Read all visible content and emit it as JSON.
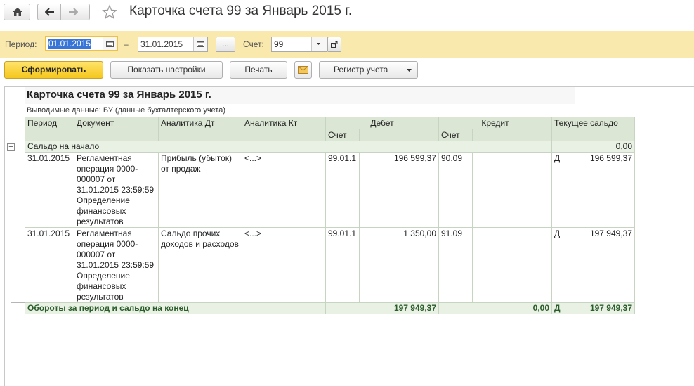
{
  "window": {
    "title": "Карточка счета 99 за Январь 2015 г."
  },
  "params": {
    "period_label": "Период:",
    "date_from": "01.01.2015",
    "dash": "–",
    "date_to": "31.01.2015",
    "more_label": "...",
    "account_label": "Счет:",
    "account_value": "99"
  },
  "toolbar": {
    "generate_label": "Сформировать",
    "settings_label": "Показать настройки",
    "print_label": "Печать",
    "register_label": "Регистр учета"
  },
  "report": {
    "title": "Карточка счета 99 за Январь 2015 г.",
    "meta": "Выводимые данные:  БУ (данные бухгалтерского учета)",
    "headers": {
      "period": "Период",
      "document": "Документ",
      "analytics_dt": "Аналитика Дт",
      "analytics_kt": "Аналитика Кт",
      "debit": "Дебет",
      "credit": "Кредит",
      "balance": "Текущее сальдо",
      "debit_account": "Счет",
      "credit_account": "Счет"
    },
    "opening": {
      "label": "Сальдо на начало",
      "value": "0,00"
    },
    "rows": [
      {
        "period": "31.01.2015",
        "document": "Регламентная операция 0000-000007 от 31.01.2015 23:59:59 Определение финансовых результатов",
        "analytics_dt": "Прибыль (убыток) от продаж",
        "analytics_kt": "<...>",
        "debit_account": "99.01.1",
        "debit_amount": "196 599,37",
        "credit_account": "90.09",
        "credit_amount": "",
        "balance_sign": "Д",
        "balance_amount": "196 599,37"
      },
      {
        "period": "31.01.2015",
        "document": "Регламентная операция 0000-000007 от 31.01.2015 23:59:59 Определение финансовых результатов",
        "analytics_dt": "Сальдо прочих доходов и расходов",
        "analytics_kt": "<...>",
        "debit_account": "99.01.1",
        "debit_amount": "1 350,00",
        "credit_account": "91.09",
        "credit_amount": "",
        "balance_sign": "Д",
        "balance_amount": "197 949,37"
      }
    ],
    "totals": {
      "label": "Обороты за период и сальдо на конец",
      "debit": "197 949,37",
      "credit": "0,00",
      "balance_sign": "Д",
      "balance": "197 949,37"
    }
  },
  "icons": {
    "home": "home-icon",
    "back": "arrow-left-icon",
    "forward": "arrow-right-icon",
    "favorite": "star-icon",
    "calendar": "calendar-icon",
    "open": "open-form-icon",
    "email": "envelope-icon",
    "collapse": "minus-square-icon"
  },
  "colors": {
    "params_bg": "#fae9ad",
    "primary_button": "#f5c71c",
    "table_header": "#dce6d5",
    "totals_text": "#2a5c2a"
  }
}
